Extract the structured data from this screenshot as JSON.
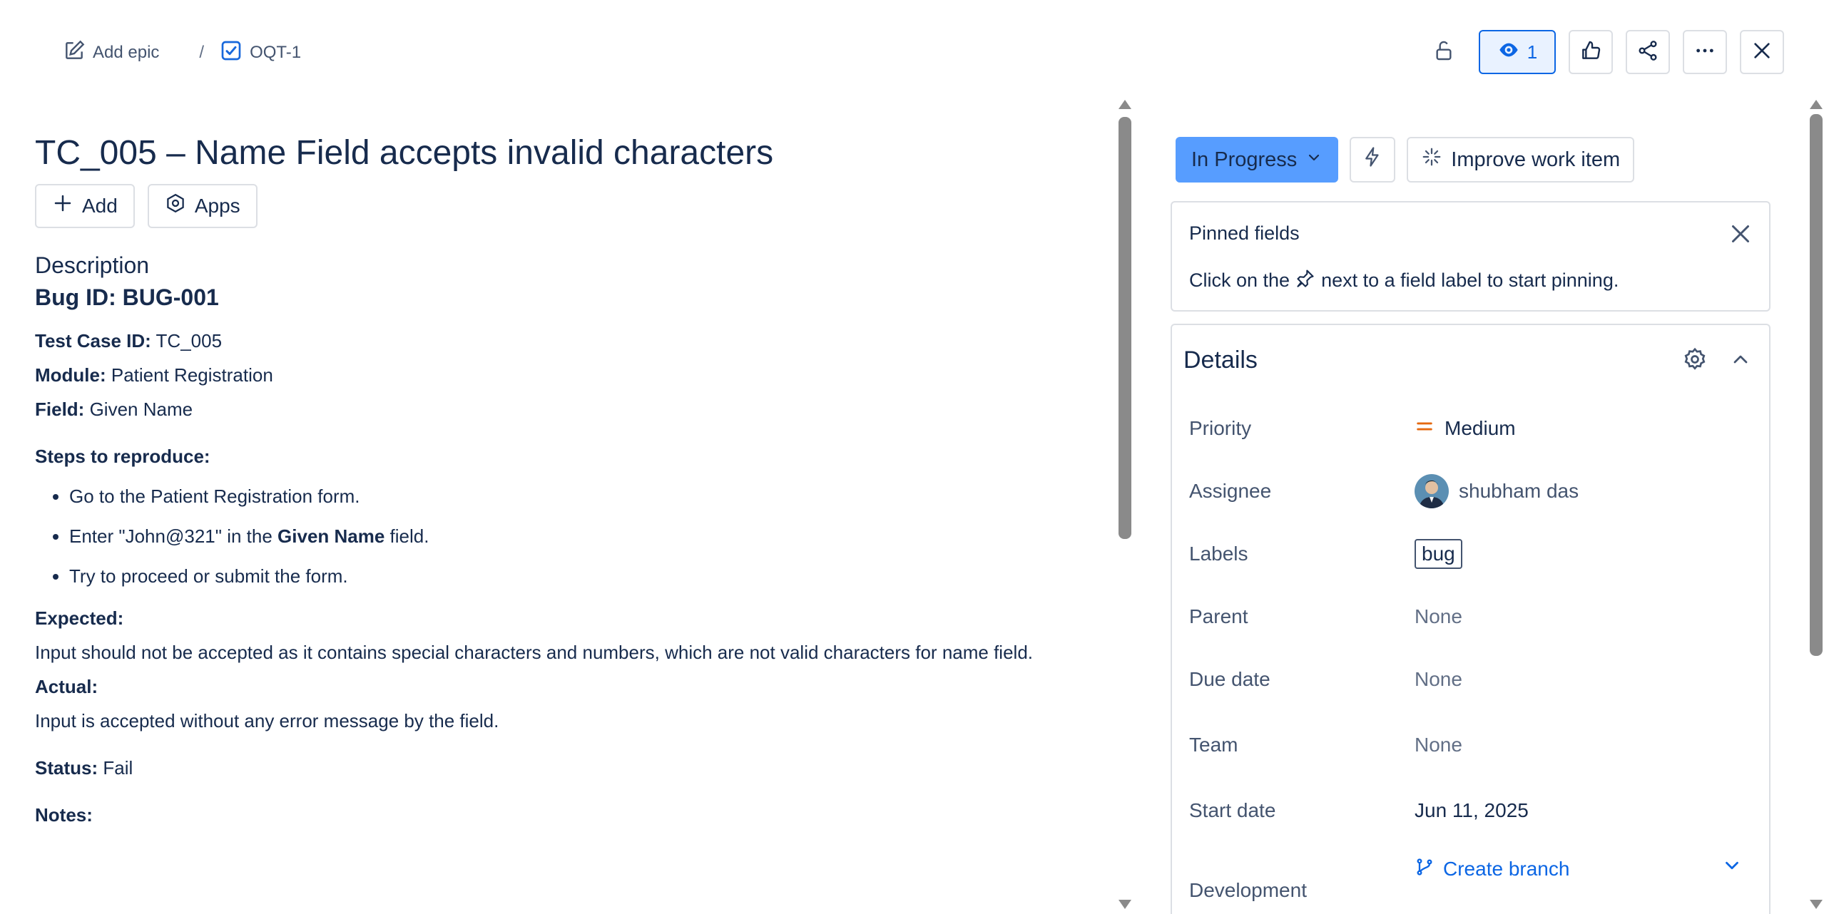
{
  "header": {
    "add_epic": "Add epic",
    "separator": "/",
    "issue_key": "OQT-1",
    "watch_count": "1"
  },
  "issue": {
    "title": "TC_005 – Name Field accepts invalid characters",
    "add_label": "Add",
    "apps_label": "Apps",
    "description_heading": "Description",
    "bug_id": "Bug ID: BUG-001",
    "test_case_label": "Test Case ID:",
    "test_case_value": " TC_005",
    "module_label": "Module:",
    "module_value": " Patient Registration",
    "field_label": "Field:",
    "field_value": " Given Name",
    "steps_heading": "Steps to reproduce:",
    "step1": "Go to the Patient Registration form.",
    "step2_pre": "Enter \"John@321\" in the ",
    "step2_bold": "Given Name",
    "step2_post": " field.",
    "step3": "Try to proceed or submit the form.",
    "expected_label": "Expected:",
    "expected_text": "Input should not be accepted as it contains special characters and numbers, which are not valid characters for name field.",
    "actual_label": "Actual:",
    "actual_text": "Input is accepted without any error message by the field.",
    "status_label": "Status:",
    "status_value": " Fail",
    "notes_label": "Notes:"
  },
  "sidebar": {
    "status": "In Progress",
    "improve": "Improve work item",
    "pinned_title": "Pinned fields",
    "pinned_pre": "Click on the",
    "pinned_post": "next to a field label to start pinning.",
    "details_title": "Details",
    "fields": {
      "priority_label": "Priority",
      "priority_value": "Medium",
      "assignee_label": "Assignee",
      "assignee_value": "shubham das",
      "labels_label": "Labels",
      "labels_value": "bug",
      "parent_label": "Parent",
      "parent_value": "None",
      "due_label": "Due date",
      "due_value": "None",
      "team_label": "Team",
      "team_value": "None",
      "start_label": "Start date",
      "start_value": "Jun 11, 2025",
      "dev_label": "Development",
      "create_branch": "Create branch"
    }
  },
  "colors": {
    "status_bg": "#579dff",
    "link": "#0c66e4",
    "priority_medium": "#e56910"
  }
}
